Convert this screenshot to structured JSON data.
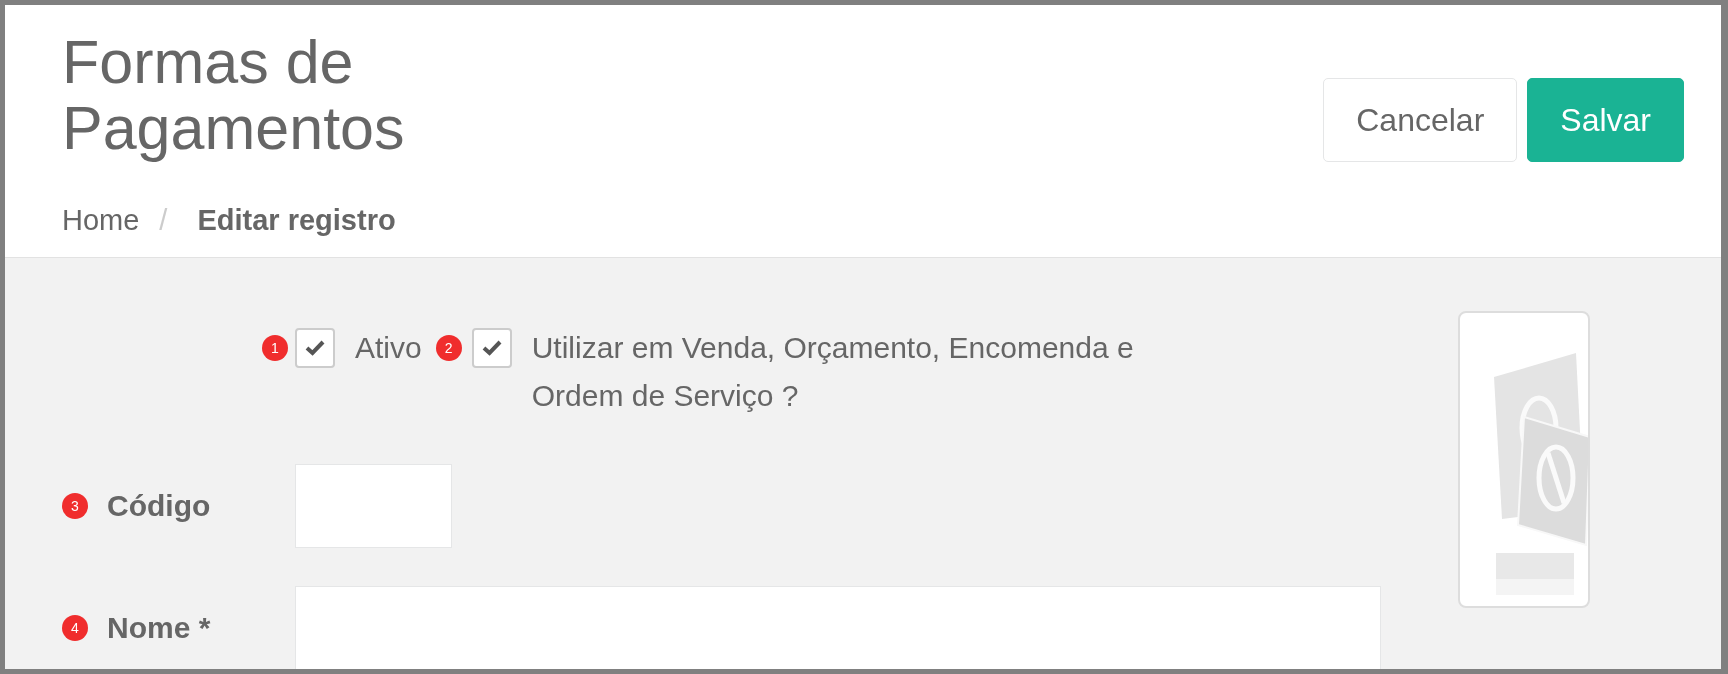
{
  "header": {
    "title": "Formas de Pagamentos",
    "buttons": [
      {
        "label": "Cancelar",
        "kind": "secondary"
      },
      {
        "label": "Salvar",
        "kind": "primary"
      }
    ],
    "breadcrumb_separator": "/",
    "breadcrumb": [
      {
        "label": "Home",
        "current": false
      },
      {
        "label": "Editar registro",
        "current": true
      }
    ]
  },
  "options": [
    {
      "badge": "1",
      "label": "Ativo",
      "checked": true
    },
    {
      "badge": "2",
      "label": "Utilizar em Venda, Orçamento, Encomenda e Ordem de Serviço ?",
      "checked": true
    }
  ],
  "fields": [
    {
      "badge": "3",
      "label": "Código",
      "kind": "short"
    },
    {
      "badge": "4",
      "label": "Nome *",
      "kind": "long"
    }
  ]
}
